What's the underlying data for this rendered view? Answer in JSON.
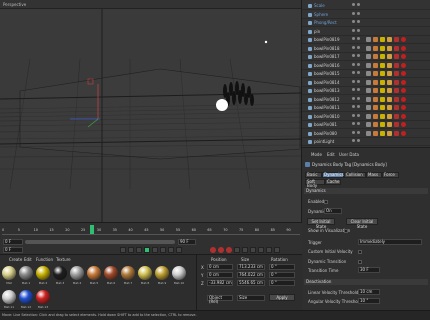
{
  "viewport": {
    "label": "Perspective"
  },
  "objects": [
    {
      "name": "Scale",
      "color": "#6fa1d8"
    },
    {
      "name": "Sphere",
      "color": "#6fa1d8"
    },
    {
      "name": "Phong/Rect",
      "color": "#6fa1d8"
    },
    {
      "name": "pin",
      "color": "#cfcfcf"
    },
    {
      "name": "bowlPin0819",
      "color": "#cfcfcf"
    },
    {
      "name": "bowlPin0818",
      "color": "#cfcfcf"
    },
    {
      "name": "bowlPin0817",
      "color": "#cfcfcf"
    },
    {
      "name": "bowlPin0816",
      "color": "#cfcfcf"
    },
    {
      "name": "bowlPin0815",
      "color": "#cfcfcf"
    },
    {
      "name": "bowlPin0814",
      "color": "#cfcfcf"
    },
    {
      "name": "bowlPin0813",
      "color": "#cfcfcf"
    },
    {
      "name": "bowlPin0812",
      "color": "#cfcfcf"
    },
    {
      "name": "bowlPin0811",
      "color": "#cfcfcf"
    },
    {
      "name": "bowlPin0810",
      "color": "#cfcfcf"
    },
    {
      "name": "bowlPin081",
      "color": "#cfcfcf"
    },
    {
      "name": "bowlPin080",
      "color": "#cfcfcf"
    },
    {
      "name": "pointLight",
      "color": "#cfcfcf"
    }
  ],
  "attr": {
    "menu": [
      "Mode",
      "Edit",
      "User Data"
    ],
    "title": "Dynamics Body Tag [Dynamics Body]",
    "tabs": [
      "Basic",
      "Dynamics",
      "Collision",
      "Mass",
      "Force"
    ],
    "tabs2": [
      "Soft Body",
      "Cache"
    ],
    "section_dynamics": "Dynamics",
    "enabled_label": "Enabled",
    "dynamic_label": "Dynamic",
    "dynamic_value": "On",
    "set_initial": "Set Initial State",
    "clear_initial": "Clear Initial State",
    "show_viz": "Show in Visualization",
    "trigger_label": "Trigger",
    "trigger_value": "Immediately",
    "custom_vel": "Custom Initial Velocity",
    "dyn_transition": "Dynamic Transition",
    "transition_time": "Transition Time",
    "transition_value": "30 F",
    "section_deactivation": "Deactivation",
    "linear_label": "Linear Velocity Threshold",
    "linear_value": "10 cm",
    "angular_label": "Angular Velocity Threshold",
    "angular_value": "10 °"
  },
  "timeline": {
    "start": "0 F",
    "end": "90 F",
    "current": "0 F",
    "ticks": [
      "0",
      "5",
      "10",
      "15",
      "20",
      "25",
      "30",
      "35",
      "40",
      "45",
      "50",
      "55",
      "60",
      "65",
      "70",
      "75",
      "80",
      "85",
      "90"
    ]
  },
  "materials": {
    "menu": [
      "Create",
      "Edit",
      "Function",
      "Texture"
    ],
    "items": [
      {
        "name": "Mat",
        "color": "#d8cf8a"
      },
      {
        "name": "Mat.1",
        "color": "#8a8a8a"
      },
      {
        "name": "Mat.2",
        "color": "#c9b200"
      },
      {
        "name": "Mat.3",
        "color": "#1e1e1e"
      },
      {
        "name": "Mat.4",
        "color": "#a0a0a0"
      },
      {
        "name": "Mat.5",
        "color": "#c87a3a"
      },
      {
        "name": "Mat.6",
        "color": "#a24a2a"
      },
      {
        "name": "Mat.7",
        "color": "#b07a3a"
      },
      {
        "name": "Mat.8",
        "color": "#d0c050"
      },
      {
        "name": "Mat.9",
        "color": "#c0a030"
      },
      {
        "name": "Mat.10",
        "color": "#cfcfcf"
      },
      {
        "name": "Mat.11",
        "color": "#d0d0d0"
      },
      {
        "name": "Mat.12",
        "color": "#2050d0"
      },
      {
        "name": "Mat.13",
        "color": "#d02020"
      }
    ]
  },
  "coords": {
    "headers": [
      "Position",
      "Size",
      "Rotation"
    ],
    "x": [
      "0 cm",
      "713.233 cm",
      "0 °"
    ],
    "y": [
      "0 cm",
      "764.022 cm",
      "0 °"
    ],
    "z": [
      "-33.982 cm",
      "5546.65 cm",
      "0 °"
    ],
    "mode": "Object (Rel)",
    "size_mode": "Size",
    "apply": "Apply"
  },
  "status": "Move: Live Selection: Click and drag to select elements. Hold down SHIFT to add to the selection, CTRL to remove."
}
